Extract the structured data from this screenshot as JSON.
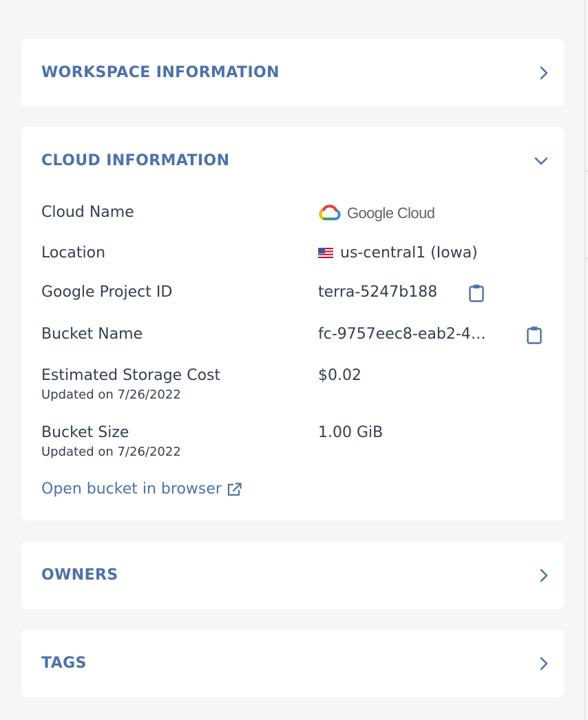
{
  "panels": {
    "workspace": {
      "title": "WORKSPACE INFORMATION",
      "expanded": false
    },
    "cloud": {
      "title": "CLOUD INFORMATION",
      "expanded": true,
      "cloud_name": {
        "label": "Cloud Name",
        "value": "Google Cloud"
      },
      "location": {
        "label": "Location",
        "value": "us-central1 (Iowa)"
      },
      "project_id": {
        "label": "Google Project ID",
        "value": "terra-5247b188"
      },
      "bucket_name": {
        "label": "Bucket Name",
        "value": "fc-9757eec8-eab2-4…"
      },
      "storage_cost": {
        "label": "Estimated Storage Cost",
        "sub": "Updated on 7/26/2022",
        "value": "$0.02"
      },
      "bucket_size": {
        "label": "Bucket Size",
        "sub": "Updated on 7/26/2022",
        "value": "1.00 GiB"
      },
      "open_link": "Open bucket in browser"
    },
    "owners": {
      "title": "OWNERS",
      "expanded": false
    },
    "tags": {
      "title": "TAGS",
      "expanded": false
    }
  },
  "colors": {
    "accent": "#4d72aa",
    "text": "#333f52",
    "background": "#f5f6f8",
    "panel": "#ffffff"
  },
  "icons": {
    "collapsed": "chevron-right-icon",
    "expanded": "chevron-down-icon",
    "copy": "clipboard-icon",
    "external": "external-link-icon",
    "flag": "us-flag-icon"
  }
}
